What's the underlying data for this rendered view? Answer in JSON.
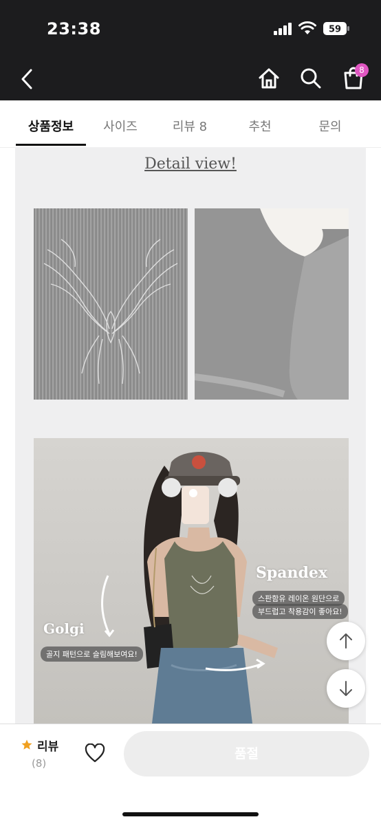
{
  "status": {
    "time": "23:38",
    "battery": "59"
  },
  "header": {
    "cart_badge": "8",
    "icons": [
      "back-chevron-icon",
      "home-icon",
      "search-icon",
      "shopping-bag-icon"
    ]
  },
  "tabs": [
    {
      "label": "상품정보",
      "active": true
    },
    {
      "label": "사이즈"
    },
    {
      "label": "리뷰 8"
    },
    {
      "label": "추천"
    },
    {
      "label": "문의"
    }
  ],
  "detail": {
    "title": "Detail view!",
    "overlay": {
      "left_title": "Golgi",
      "left_caption": "골지 패턴으로 슬림해보여요!",
      "right_title": "Spandex",
      "right_caption_1": "스판함유 레이온 원단으로",
      "right_caption_2": "부드럽고 착용감이 좋아요!"
    }
  },
  "bottom": {
    "review_label": "리뷰",
    "review_count": "(8)",
    "cta_label": "품절"
  },
  "colors": {
    "dark_bar": "#1c1c1e",
    "badge": "#e056c2",
    "star": "#f0a020",
    "content_bg": "#efeff0"
  }
}
